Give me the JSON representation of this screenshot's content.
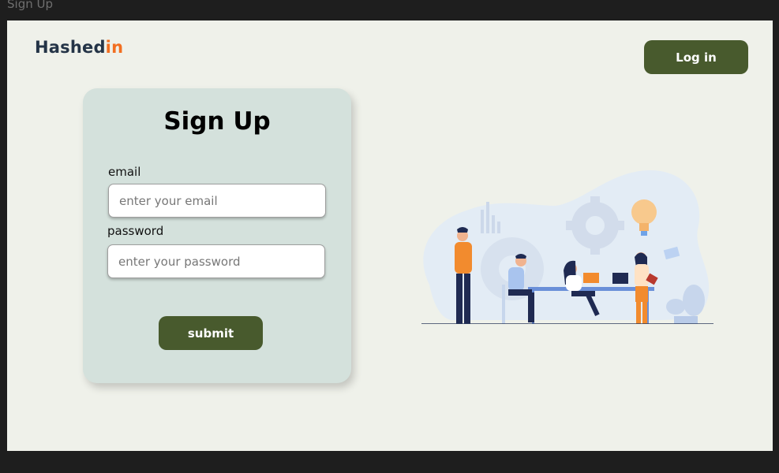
{
  "window": {
    "frame_label": "Sign Up"
  },
  "header": {
    "logo_main": "Hashed",
    "logo_accent": "in",
    "login_label": "Log in"
  },
  "form": {
    "title": "Sign Up",
    "email_label": "email",
    "email_placeholder": "enter your email",
    "email_value": "",
    "password_label": "password",
    "password_placeholder": "enter your password",
    "password_value": "",
    "submit_label": "submit"
  },
  "illustration": {
    "name": "team-meeting-illustration"
  },
  "colors": {
    "background": "#eff1ea",
    "card": "#d4e1dc",
    "primary_button": "#485a2d",
    "logo_text": "#243447",
    "logo_accent": "#f26f21",
    "app_frame": "#1e1e1e"
  }
}
